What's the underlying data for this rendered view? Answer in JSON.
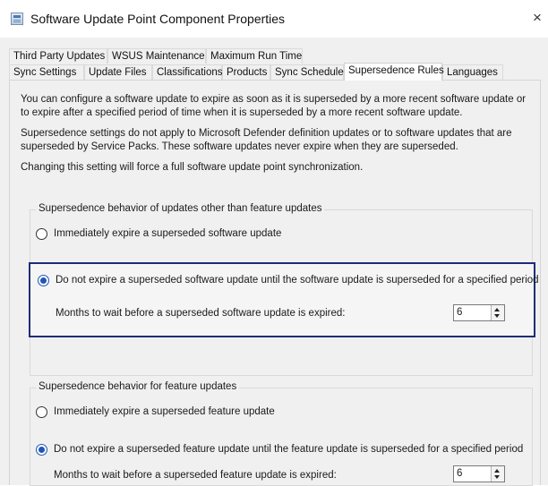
{
  "window": {
    "title": "Software Update Point Component Properties",
    "close_glyph": "×",
    "icon": "properties-window-icon"
  },
  "tabs": {
    "row1": [
      "Third Party Updates",
      "WSUS Maintenance",
      "Maximum Run Time"
    ],
    "row2": [
      "Sync Settings",
      "Update Files",
      "Classifications",
      "Products",
      "Sync Schedule",
      "Supersedence Rules",
      "Languages"
    ],
    "selected": "Supersedence Rules"
  },
  "description": {
    "p1": "You can configure a software update to expire as soon as it is superseded by a more recent software update or to expire after a specified period of time when it is superseded by a more recent software update.",
    "p2": "Supersedence settings do not apply to Microsoft Defender definition updates or to software updates that are superseded by Service Packs. These software updates never expire when they are superseded.",
    "p3": "Changing this setting will force a full software update point synchronization."
  },
  "group_other": {
    "legend": "Supersedence behavior of updates other than feature updates",
    "option_immediate": "Immediately expire a superseded software update",
    "option_wait": "Do not expire a superseded software update until the software update is superseded for a specified period",
    "selected": "wait",
    "months_label": "Months to wait before a superseded software update is expired:",
    "months_value": "6"
  },
  "group_feature": {
    "legend": "Supersedence behavior for feature updates",
    "option_immediate": "Immediately expire a superseded feature update",
    "option_wait": "Do not expire a superseded feature update until the feature update is superseded for a specified period",
    "selected": "wait",
    "months_label": "Months to wait before a superseded feature update is expired:",
    "months_value": "6"
  },
  "colors": {
    "selection_highlight_border": "#1f2d77",
    "radio_accent": "#1f56b7"
  }
}
